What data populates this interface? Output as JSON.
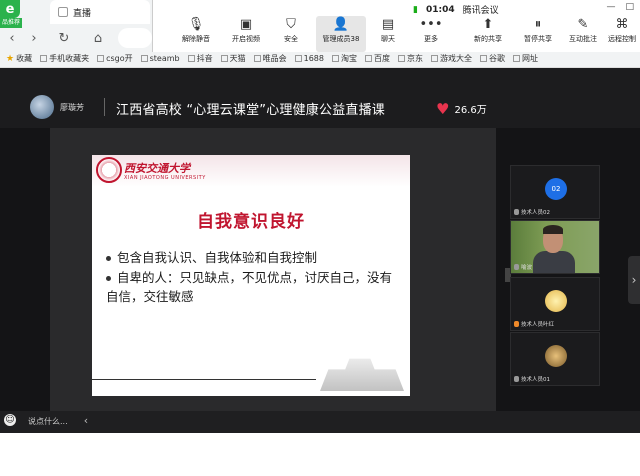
{
  "browser": {
    "logo_letter": "e",
    "logo_tag": "品推荐",
    "tab_title": "直播",
    "bookmarks": [
      "收藏",
      "手机收藏夹",
      "csgo开",
      "steamb",
      "抖音",
      "天猫",
      "唯品会",
      "1688",
      "淘宝",
      "百度",
      "京东",
      "游戏大全",
      "谷歌",
      "网址"
    ]
  },
  "meeting": {
    "time": "01:04",
    "app_name": "腾讯会议",
    "tools": [
      {
        "label": "解除静音",
        "icon": "mic-off-icon"
      },
      {
        "label": "开启视频",
        "icon": "camera-off-icon"
      },
      {
        "label": "安全",
        "icon": "shield-icon"
      },
      {
        "label": "管理成员",
        "icon": "members-icon",
        "count": "38"
      },
      {
        "label": "聊天",
        "icon": "chat-icon"
      },
      {
        "label": "更多",
        "icon": "more-icon"
      },
      {
        "label": "新的共享",
        "icon": "share-icon"
      },
      {
        "label": "暂停共享",
        "icon": "pause-icon"
      },
      {
        "label": "互动批注",
        "icon": "annotate-icon"
      },
      {
        "label": "远程控制",
        "icon": "remote-icon"
      }
    ]
  },
  "live": {
    "anchor": "廖璇芳",
    "title": "江西省高校 “心理云课堂”心理健康公益直播课",
    "likes": "26.6万"
  },
  "slide": {
    "university_cn": "西安交通大学",
    "university_en": "XIAN JIAOTONG UNIVERSITY",
    "heading": "自我意识良好",
    "bullet1": "包含自我认识、自我体验和自我控制",
    "bullet2": "自卑的人：只见缺点，不见优点，讨厌自己，没有自信，交往敏感"
  },
  "participants": [
    {
      "avatar_text": "02",
      "name": "技术人员02"
    },
    {
      "name": "喻波"
    },
    {
      "name": "技术人员叶红"
    },
    {
      "name": "技术人员01"
    }
  ],
  "chat": {
    "placeholder": "说点什么..."
  }
}
